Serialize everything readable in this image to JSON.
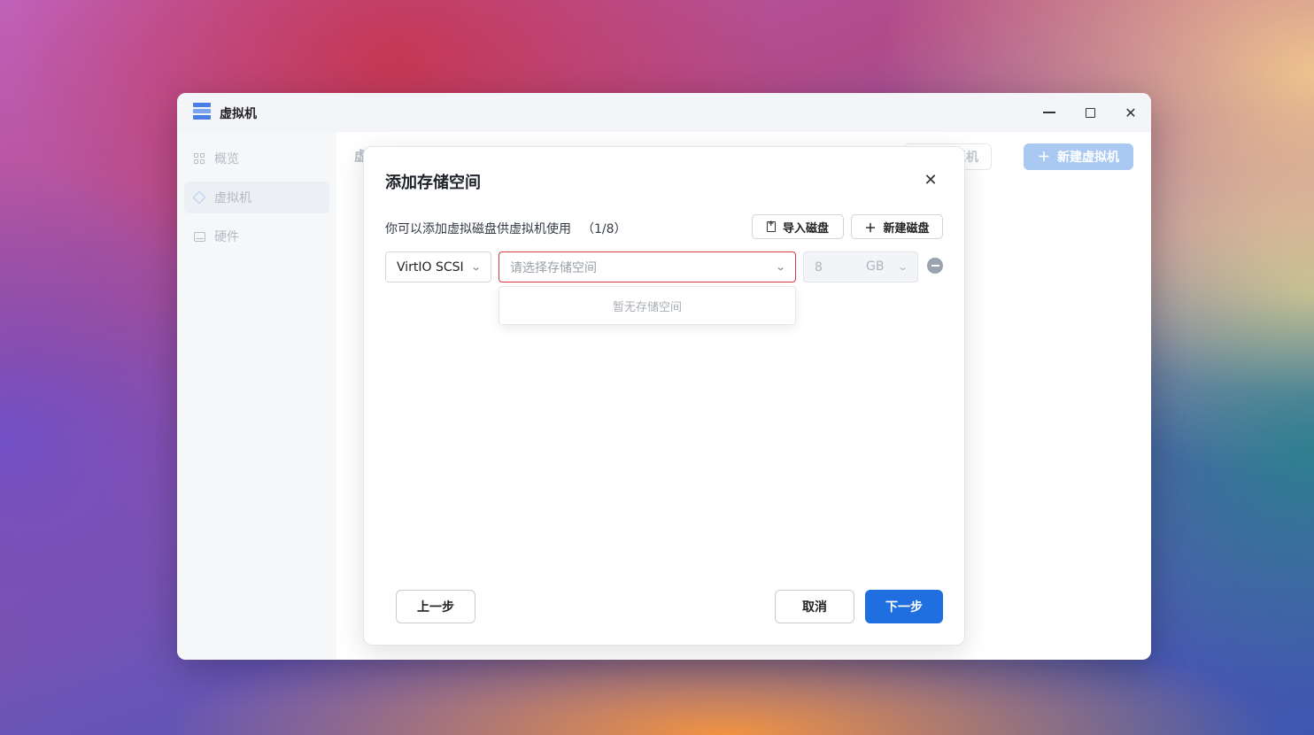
{
  "app": {
    "title": "虚拟机"
  },
  "sidebar": {
    "items": [
      {
        "label": "概览",
        "icon": "grid-icon"
      },
      {
        "label": "虚拟机",
        "icon": "cube-icon",
        "active": true
      },
      {
        "label": "硬件",
        "icon": "hard-drive-icon"
      }
    ]
  },
  "background_page": {
    "section_title_partial": "虚",
    "vm_button_label": "虚拟机",
    "new_vm_button_label": "新建虚拟机"
  },
  "dialog": {
    "title": "添加存储空间",
    "description": "你可以添加虚拟磁盘供虚拟机使用",
    "count": "（1/8）",
    "import_disk_label": "导入磁盘",
    "new_disk_label": "新建磁盘",
    "disk_row": {
      "controller_type": "VirtIO SCSI",
      "storage_placeholder": "请选择存储空间",
      "size_value": "8",
      "size_unit": "GB"
    },
    "dropdown_empty_text": "暂无存储空间",
    "prev_label": "上一步",
    "cancel_label": "取消",
    "next_label": "下一步"
  },
  "colors": {
    "primary": "#1f6fe0",
    "error_border": "#d9363e"
  }
}
